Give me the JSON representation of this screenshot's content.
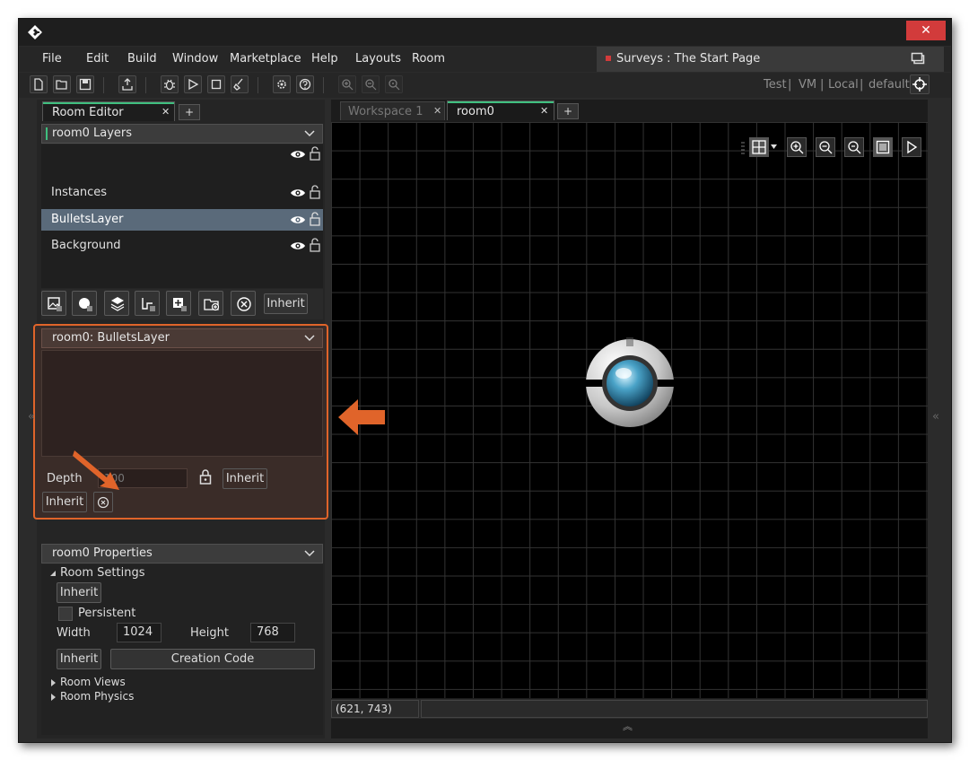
{
  "window": {
    "close_glyph": "✕",
    "menu": [
      "File",
      "Edit",
      "Build",
      "Window",
      "Marketplace",
      "Help",
      "Layouts",
      "Room"
    ],
    "feed_title": "Surveys : The Start Page",
    "targets": {
      "test": "Test",
      "sep1": "|",
      "vm": "VM",
      "sep2": "|",
      "local": "Local",
      "sep3": "|",
      "default": "default"
    }
  },
  "left_panel": {
    "tab_label": "Room Editor",
    "tab_close": "✕",
    "tab_add": "+",
    "layers_header": "room0 Layers",
    "layers": [
      {
        "label": "Instances"
      },
      {
        "label": "BulletsLayer"
      },
      {
        "label": "Background"
      }
    ],
    "layer_toolbar_inherit": "Inherit",
    "layer_props_header": "room0: BulletsLayer",
    "depth_label": "Depth",
    "depth_value": "100",
    "depth_inherit": "Inherit",
    "layer_inherit": "Inherit",
    "room_props_header": "room0 Properties",
    "room_settings_label": "Room Settings",
    "room_settings_inherit": "Inherit",
    "persistent_label": "Persistent",
    "width_label": "Width",
    "width_value": "1024",
    "height_label": "Height",
    "height_value": "768",
    "creation_inherit": "Inherit",
    "creation_code": "Creation Code",
    "room_views": "Room Views",
    "room_physics": "Room Physics",
    "collapse_glyph": "«"
  },
  "workspace": {
    "tabs": [
      {
        "label": "Workspace 1",
        "close": "✕"
      },
      {
        "label": "room0",
        "close": "✕"
      }
    ],
    "tab_add": "+",
    "coords": "(621, 743)",
    "right_collapse_glyph": "«",
    "bottom_expand_glyph": "︽"
  },
  "colors": {
    "accent_orange": "#e0642a",
    "accent_green": "#3fbf7f",
    "selected_row": "#5a6a7a",
    "close_red": "#d23b3b"
  }
}
